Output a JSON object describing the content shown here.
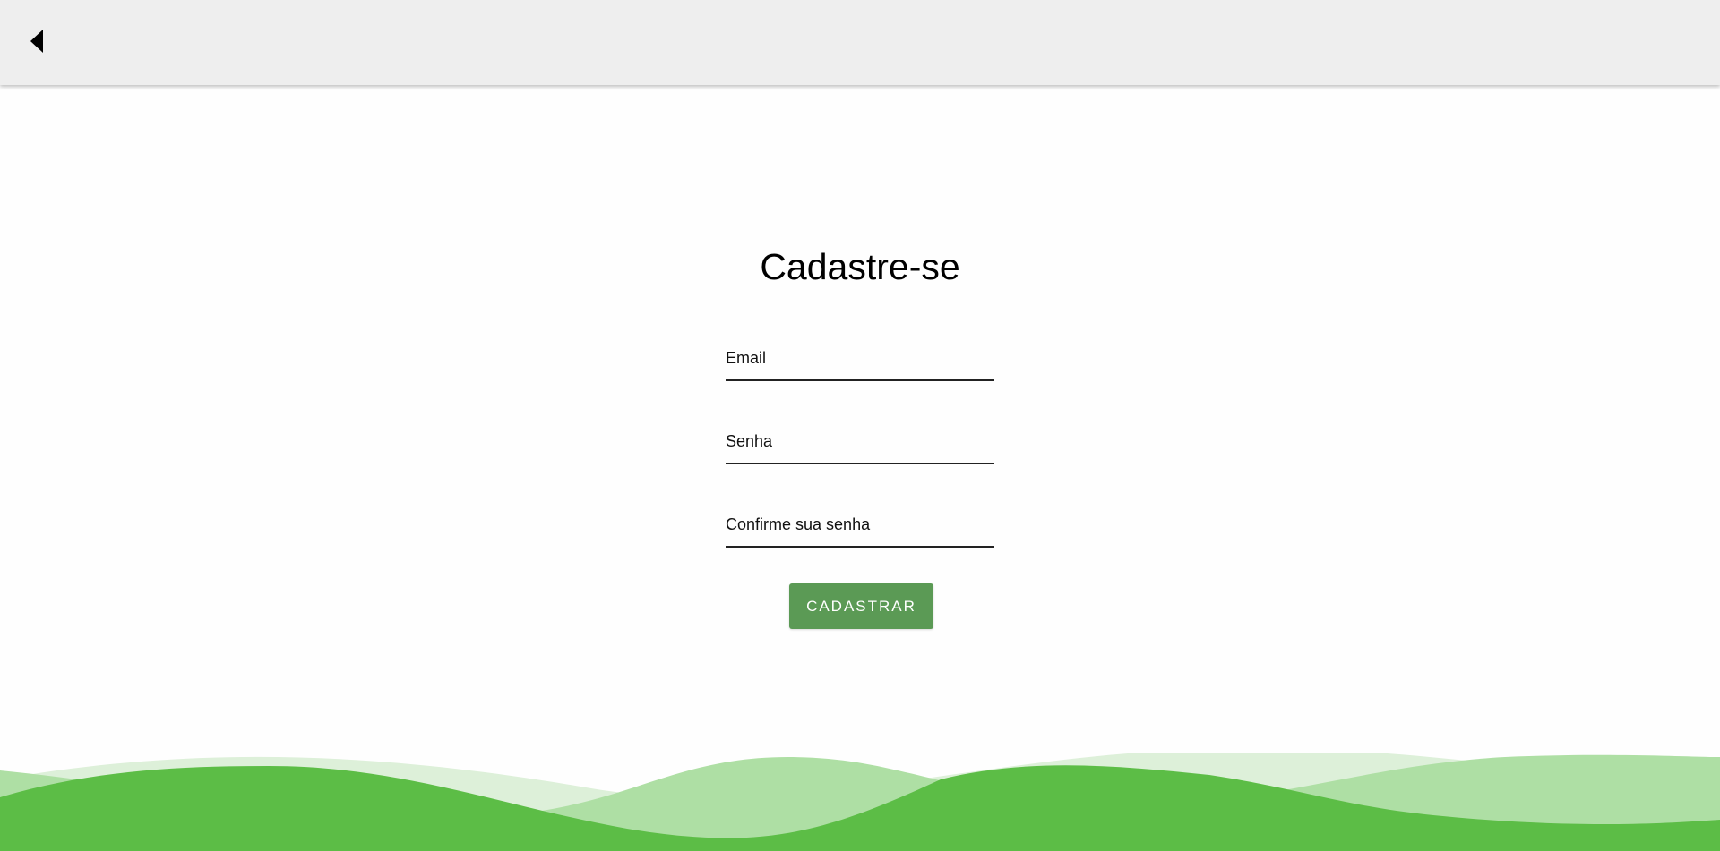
{
  "header": {
    "back_icon": "back-arrow-icon"
  },
  "form": {
    "title": "Cadastre-se",
    "email_placeholder": "Email",
    "password_placeholder": "Senha",
    "confirm_placeholder": "Confirme sua senha",
    "submit_label": "CADASTRAR"
  },
  "colors": {
    "topbar": "#eeeeee",
    "button": "#5b9a55",
    "wave_dark": "#5cbd46",
    "wave_mid": "#aedfa4",
    "wave_light": "#ddf0d9"
  }
}
